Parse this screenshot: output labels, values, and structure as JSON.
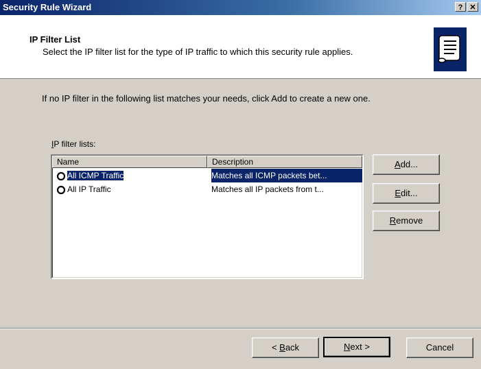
{
  "window": {
    "title": "Security Rule Wizard",
    "help_button": "?",
    "close_button": "✕"
  },
  "header": {
    "title": "IP Filter List",
    "subtitle": "Select the IP filter list for the type of IP traffic to which this security rule applies."
  },
  "body": {
    "intro": "If no IP filter in the following list matches your needs, click Add to create a new one.",
    "list_label_mnemonic": "I",
    "list_label_rest": "P filter lists:"
  },
  "list": {
    "columns": [
      "Name",
      "Description"
    ],
    "rows": [
      {
        "name": "All ICMP Traffic",
        "description": "Matches all ICMP packets bet...",
        "selected": true
      },
      {
        "name": "All IP Traffic",
        "description": "Matches all IP packets from t...",
        "selected": false
      }
    ]
  },
  "side_buttons": {
    "add": {
      "mnemonic": "A",
      "rest": "dd..."
    },
    "edit": {
      "mnemonic": "E",
      "rest": "dit..."
    },
    "remove": {
      "mnemonic": "R",
      "rest": "emove"
    }
  },
  "footer_buttons": {
    "back_prefix": "< ",
    "back_mnemonic": "B",
    "back_rest": "ack",
    "next_mnemonic": "N",
    "next_rest": "ext >",
    "cancel": "Cancel"
  },
  "colors": {
    "title_bar": "#0a246a",
    "selection": "#0a246a",
    "face": "#d4d0c8"
  }
}
